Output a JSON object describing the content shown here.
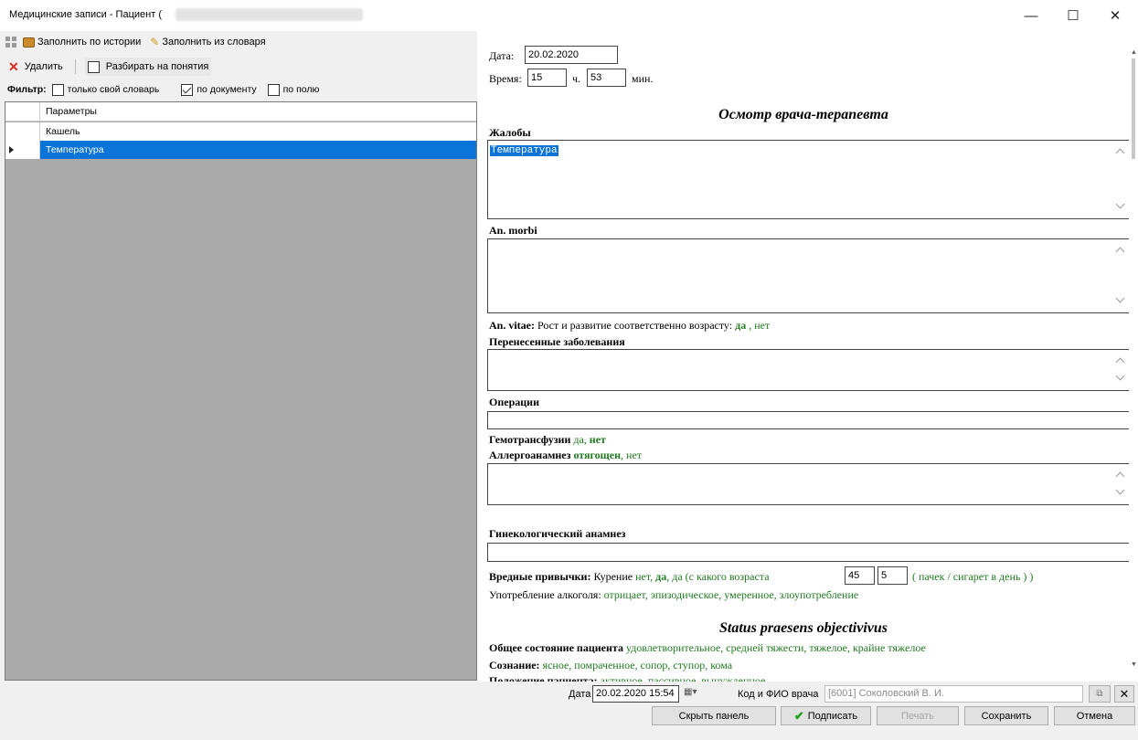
{
  "window": {
    "title": "Медицинские записи - Пациент (",
    "minimize": "—",
    "maximize": "☐",
    "close": "✕"
  },
  "left": {
    "toolbar": {
      "fill_history": "Заполнить по истории",
      "fill_dictionary": "Заполнить из словаря",
      "delete": "Удалить",
      "split_concepts": "Разбирать на понятия"
    },
    "filter": {
      "label": "Фильтр:",
      "own_dict": "только свой словарь",
      "by_document": "по документу",
      "by_field": "по полю"
    },
    "grid": {
      "header": "Параметры",
      "rows": [
        "Кашель",
        "Температура"
      ]
    }
  },
  "doc": {
    "date_label": "Дата:",
    "date_value": "20.02.2020",
    "time_label": "Время:",
    "hour_value": "15",
    "hour_unit": "ч.",
    "min_value": "53",
    "min_unit": "мин.",
    "title": "Осмотр врача-терапевта",
    "complaints_label": "Жалобы",
    "complaints_value": "Температура",
    "anmorbi_label": "An. morbi",
    "anvitae_label": "An. vitae:",
    "anvitae_text": " Рост и развитие соответственно возрасту: ",
    "anvitae_yes": "да",
    "anvitae_sep": " , ",
    "anvitae_no": "нет",
    "past_diseases_label": "Перенесенные заболевания",
    "operations_label": "Операции",
    "hemo_label": "Гемотрансфузии",
    "hemo_yes": " да",
    "hemo_comma": ",",
    "hemo_no": " нет",
    "allergy_label": "Аллергоанамнез",
    "allergy_burdened": " отягощен",
    "allergy_comma": ",",
    "allergy_no": " нет",
    "gyn_label": "Гинекологический анамнез",
    "habits_label": "Вредные привычки:",
    "smoking_text": " Курение ",
    "smoking_no": "нет",
    "smoking_yes": "да",
    "smoking_yes_since": "да (с какого возраста",
    "smoking_age": "45",
    "smoking_count": "5",
    "smoking_unit": "( пачек / сигарет в день ) )",
    "alcohol_label": "Употребление алкоголя: ",
    "alcohol_options": "отрицает, эпизодическое, умеренное, злоупотребление",
    "status_title": "Status praesens objectivivus",
    "general_label": "Общее состояние пациента",
    "general_options": " удовлетворительное, средней тяжести, тяжелое, крайне тяжелое",
    "consciousness_label": "Сознание:",
    "consciousness_options": " ясное, помраченное, сопор, ступор, кома",
    "position_label": "Положение пациента:",
    "position_options": " активное, пассивное, вынужденное"
  },
  "bottom": {
    "date_label": "Дата",
    "date_value": "20.02.2020 15:54",
    "doctor_label": "Код и ФИО врача",
    "doctor_value": "[6001] Соколовский В. И.",
    "hide_panel": "Скрыть панель",
    "sign": "Подписать",
    "print": "Печать",
    "save": "Сохранить",
    "cancel": "Отмена"
  },
  "colors": {
    "selection": "#0a74d8",
    "option_green": "#1f7a1f",
    "grid_bg": "#aaaaaa"
  }
}
